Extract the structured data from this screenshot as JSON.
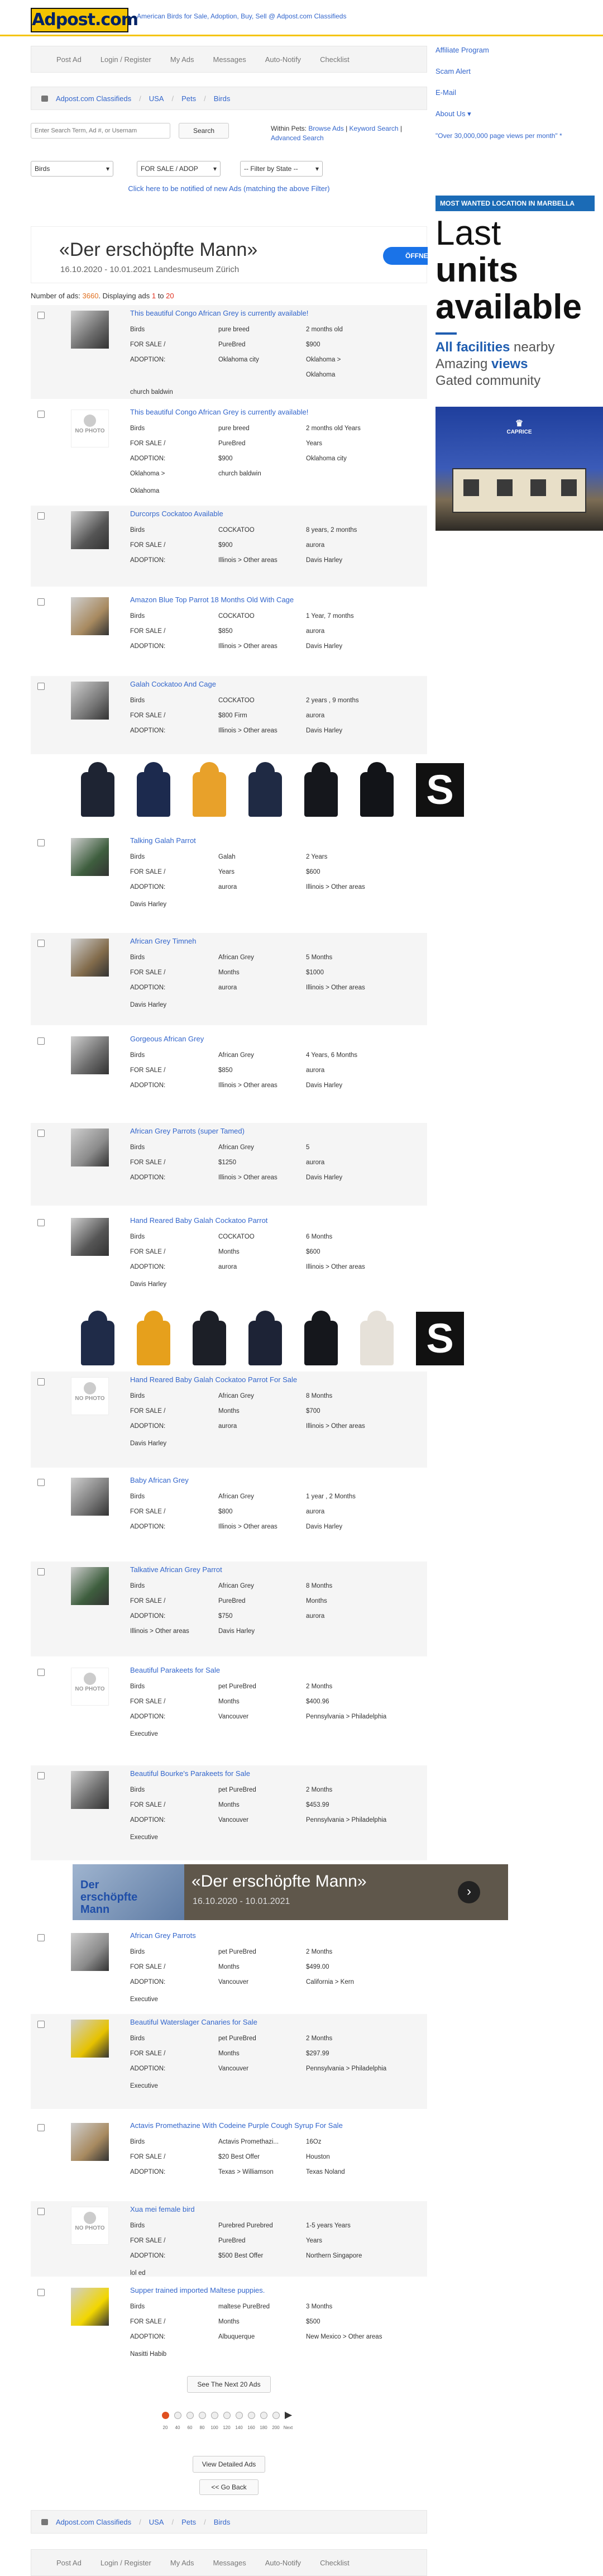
{
  "site": {
    "logo": "Adpost.com",
    "tagline": "American Birds for Sale, Adoption, Buy, Sell @ Adpost.com Classifieds"
  },
  "topnav": [
    "Post Ad",
    "Login / Register",
    "My Ads",
    "Messages",
    "Auto-Notify",
    "Checklist"
  ],
  "breadcrumb": [
    "Adpost.com Classifieds",
    "USA",
    "Pets",
    "Birds"
  ],
  "search": {
    "placeholder": "Enter Search Term, Ad #, or Usernam",
    "button": "Search",
    "within_label": "Within Pets:",
    "browse_ads": "Browse Ads",
    "keyword_search": "Keyword Search",
    "advanced_search": "Advanced Search"
  },
  "filters": {
    "category": "Birds",
    "type": "FOR SALE / ADOP",
    "state": "-- Filter by State --"
  },
  "notify_link": "Click here to be notified of new Ads (matching the above Filter)",
  "ad_banner": {
    "headline": "«Der erschöpfte Mann»",
    "details": "16.10.2020 - 10.01.2021 Landesmuseum Zürich",
    "button": "ÖFFNEN"
  },
  "results": {
    "label": "Number of ads:",
    "count": "3660",
    "displaying_label": "Displaying ads",
    "from": "1",
    "to_label": "to",
    "to": "20"
  },
  "sidebar": {
    "links": [
      "Affiliate Program",
      "Scam Alert",
      "E-Mail",
      "About Us"
    ],
    "stat": "\"Over 30,000,000 page views per month\" *",
    "most_wanted": "MOST WANTED LOCATION IN MARBELLA"
  },
  "side_ad": {
    "line1": "Last",
    "line2": "units",
    "line3": "available",
    "all_facilities": "All facilities",
    "nearby": " nearby",
    "amazing": "Amazing ",
    "views": "views",
    "gated": "Gated community",
    "brand": "CAPRICE"
  },
  "listings": [
    {
      "title": "This beautiful Congo African Grey is currently available!",
      "photo": "bird",
      "rows": [
        [
          "Birds",
          "pure breed",
          "2 months old"
        ],
        [
          "FOR SALE /",
          "PureBred",
          "$900"
        ],
        [
          "ADOPTION:",
          "Oklahoma city",
          "Oklahoma >"
        ],
        [
          "",
          "",
          "Oklahoma"
        ]
      ],
      "extra": [
        "church baldwin"
      ]
    },
    {
      "title": "This beautiful Congo African Grey is currently available!",
      "photo": "none",
      "rows": [
        [
          "Birds",
          "pure breed",
          "2 months old Years"
        ],
        [
          "FOR SALE /",
          "PureBred",
          "Years"
        ],
        [
          "ADOPTION:",
          "$900",
          "Oklahoma city"
        ],
        [
          "Oklahoma >",
          "church baldwin",
          ""
        ]
      ],
      "extra": [
        "Oklahoma"
      ]
    },
    {
      "title": "Durcorps Cockatoo Available",
      "photo": "bird",
      "rows": [
        [
          "Birds",
          "COCKATOO",
          "8 years, 2 months"
        ],
        [
          "FOR SALE /",
          "$900",
          "aurora"
        ],
        [
          "ADOPTION:",
          "Illinois > Other areas",
          "Davis Harley"
        ]
      ],
      "extra": []
    },
    {
      "title": "Amazon Blue Top Parrot 18 Months Old With Cage",
      "photo": "bird",
      "rows": [
        [
          "Birds",
          "COCKATOO",
          "1 Year, 7 months"
        ],
        [
          "FOR SALE /",
          "$850",
          "aurora"
        ],
        [
          "ADOPTION:",
          "Illinois > Other areas",
          "Davis Harley"
        ]
      ],
      "extra": []
    },
    {
      "title": "Galah Cockatoo And Cage",
      "photo": "bird",
      "rows": [
        [
          "Birds",
          "COCKATOO",
          "2 years , 9 months"
        ],
        [
          "FOR SALE /",
          "$800 Firm",
          "aurora"
        ],
        [
          "ADOPTION:",
          "Illinois > Other areas",
          "Davis Harley"
        ]
      ],
      "extra": []
    },
    {
      "title": "Talking Galah Parrot",
      "photo": "bird",
      "rows": [
        [
          "Birds",
          "Galah",
          "2 Years"
        ],
        [
          "FOR SALE /",
          "Years",
          "$600"
        ],
        [
          "ADOPTION:",
          "aurora",
          "Illinois > Other areas"
        ]
      ],
      "extra": [
        "Davis Harley"
      ]
    },
    {
      "title": "African Grey Timneh",
      "photo": "bird",
      "rows": [
        [
          "Birds",
          "African Grey",
          "5 Months"
        ],
        [
          "FOR SALE /",
          "Months",
          "$1000"
        ],
        [
          "ADOPTION:",
          "aurora",
          "Illinois > Other areas"
        ]
      ],
      "extra": [
        "Davis Harley"
      ]
    },
    {
      "title": "Gorgeous African Grey",
      "photo": "bird",
      "rows": [
        [
          "Birds",
          "African Grey",
          "4 Years, 6 Months"
        ],
        [
          "FOR SALE /",
          "$850",
          "aurora"
        ],
        [
          "ADOPTION:",
          "Illinois > Other areas",
          "Davis Harley"
        ]
      ],
      "extra": []
    },
    {
      "title": "African Grey Parrots (super Tamed)",
      "photo": "bird",
      "rows": [
        [
          "Birds",
          "African Grey",
          "5"
        ],
        [
          "FOR SALE /",
          "$1250",
          "aurora"
        ],
        [
          "ADOPTION:",
          "Illinois > Other areas",
          "Davis Harley"
        ]
      ],
      "extra": []
    },
    {
      "title": "Hand Reared Baby Galah Cockatoo Parrot",
      "photo": "bird",
      "rows": [
        [
          "Birds",
          "COCKATOO",
          "6 Months"
        ],
        [
          "FOR SALE /",
          "Months",
          "$600"
        ],
        [
          "ADOPTION:",
          "aurora",
          "Illinois > Other areas"
        ]
      ],
      "extra": [
        "Davis Harley"
      ]
    },
    {
      "title": "Hand Reared Baby Galah Cockatoo Parrot For Sale",
      "photo": "none",
      "rows": [
        [
          "Birds",
          "African Grey",
          "8 Months"
        ],
        [
          "FOR SALE /",
          "Months",
          "$700"
        ],
        [
          "ADOPTION:",
          "aurora",
          "Illinois > Other areas"
        ]
      ],
      "extra": [
        "Davis Harley"
      ]
    },
    {
      "title": "Baby African Grey",
      "photo": "bird",
      "rows": [
        [
          "Birds",
          "African Grey",
          "1 year , 2 Months"
        ],
        [
          "FOR SALE /",
          "$800",
          "aurora"
        ],
        [
          "ADOPTION:",
          "Illinois > Other areas",
          "Davis Harley"
        ]
      ],
      "extra": []
    },
    {
      "title": "Talkative African Grey Parrot",
      "photo": "bird",
      "rows": [
        [
          "Birds",
          "African Grey",
          "8 Months"
        ],
        [
          "FOR SALE /",
          "PureBred",
          "Months"
        ],
        [
          "ADOPTION:",
          "$750",
          "aurora"
        ],
        [
          "Illinois > Other areas",
          "Davis Harley",
          ""
        ]
      ],
      "extra": []
    },
    {
      "title": "Beautiful Parakeets for Sale",
      "photo": "none",
      "rows": [
        [
          "Birds",
          "pet PureBred",
          "2 Months"
        ],
        [
          "FOR SALE /",
          "Months",
          "$400.96"
        ],
        [
          "ADOPTION:",
          "Vancouver",
          "Pennsylvania > Philadelphia"
        ]
      ],
      "extra": [
        "Executive"
      ]
    },
    {
      "title": "Beautiful Bourke's Parakeets for Sale",
      "photo": "bird",
      "rows": [
        [
          "Birds",
          "pet PureBred",
          "2 Months"
        ],
        [
          "FOR SALE /",
          "Months",
          "$453.99"
        ],
        [
          "ADOPTION:",
          "Vancouver",
          "Pennsylvania > Philadelphia"
        ]
      ],
      "extra": [
        "Executive"
      ]
    },
    {
      "title": "African Grey Parrots",
      "photo": "bird",
      "rows": [
        [
          "Birds",
          "pet PureBred",
          "2 Months"
        ],
        [
          "FOR SALE /",
          "Months",
          "$499.00"
        ],
        [
          "ADOPTION:",
          "Vancouver",
          "California > Kern"
        ]
      ],
      "extra": [
        "Executive"
      ]
    },
    {
      "title": "Beautiful Waterslager Canaries for Sale",
      "photo": "canary",
      "rows": [
        [
          "Birds",
          "pet PureBred",
          "2 Months"
        ],
        [
          "FOR SALE /",
          "Months",
          "$297.99"
        ],
        [
          "ADOPTION:",
          "Vancouver",
          "Pennsylvania > Philadelphia"
        ]
      ],
      "extra": [
        "Executive"
      ]
    },
    {
      "title": "Actavis Promethazine With Codeine Purple Cough Syrup For Sale",
      "photo": "bird",
      "rows": [
        [
          "Birds",
          "Actavis Promethazi...",
          "16Oz"
        ],
        [
          "FOR SALE /",
          "$20 Best Offer",
          "Houston"
        ],
        [
          "ADOPTION:",
          "Texas > Williamson",
          "Texas Noland"
        ]
      ],
      "extra": []
    },
    {
      "title": "Xua mei female bird",
      "photo": "none",
      "rows": [
        [
          "Birds",
          "Purebred Purebred",
          "1-5 years Years"
        ],
        [
          "FOR SALE /",
          "PureBred",
          "Years"
        ],
        [
          "ADOPTION:",
          "$500 Best Offer",
          "Northern Singapore"
        ]
      ],
      "extra": [
        "lol ed"
      ]
    },
    {
      "title": "Supper trained imported Maltese puppies.",
      "photo": "snap",
      "rows": [
        [
          "Birds",
          "maltese PureBred",
          "3 Months"
        ],
        [
          "FOR SALE /",
          "Months",
          "$500"
        ],
        [
          "ADOPTION:",
          "Albuquerque",
          "New Mexico > Other areas"
        ]
      ],
      "extra": [
        "Nasitti Habib"
      ]
    }
  ],
  "pagination": {
    "see_next": "See The Next 20 Ads",
    "labels": [
      "20",
      "40",
      "60",
      "80",
      "100",
      "120",
      "140",
      "160",
      "180",
      "200",
      "Next"
    ],
    "view_detailed": "View Detailed Ads",
    "go_back": "<< Go Back"
  },
  "inline_ad": {
    "headline": "«Der erschöpfte Mann»",
    "details": "16.10.2020 - 10.01.2021",
    "statue_text": "Der erschöpfte Mann"
  },
  "colors": {
    "accent": "#f5c400",
    "link": "#3366cc",
    "most_wanted_bg": "#1b6bb6"
  }
}
